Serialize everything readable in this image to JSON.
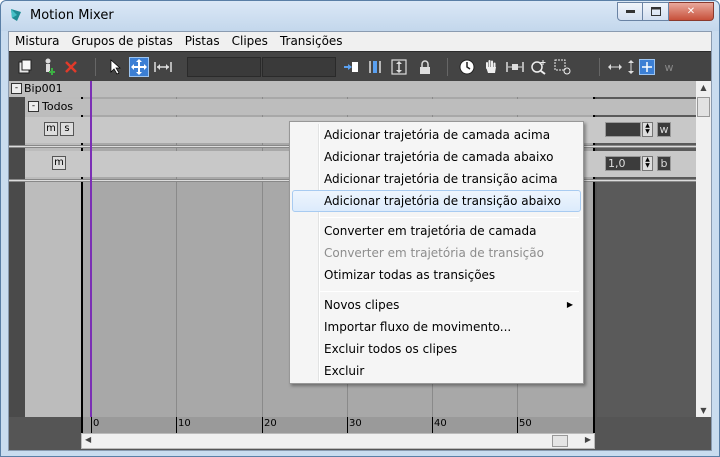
{
  "window": {
    "title": "Motion Mixer",
    "controls": {
      "minimize": "–",
      "maximize": "□",
      "close": "✕"
    }
  },
  "menubar": {
    "items": [
      "Mistura",
      "Grupos de pistas",
      "Pistas",
      "Clipes",
      "Transições"
    ]
  },
  "toolbar": {
    "icons": [
      "mixer-add-icon",
      "character-add-icon",
      "delete-icon",
      "select-arrow-icon",
      "move-icon",
      "scale-clip-icon",
      "set-range-icon",
      "snap-icon",
      "fit-icon",
      "lock-icon",
      "time-icon",
      "pan-hand-icon",
      "zoom-extents-icon",
      "zoom-icon",
      "zoom-region-icon",
      "horizontal-resize-icon",
      "vertical-resize-icon",
      "grid-toggle-icon",
      "w-icon"
    ],
    "w_label": "w"
  },
  "tracks": {
    "root_label": "Bip001",
    "root_collapse": "-",
    "group_label": "Todos",
    "group_collapse": "-",
    "track1_buttons": [
      "m",
      "s"
    ],
    "track1_weight_label": "w",
    "track2_buttons": [
      "m"
    ],
    "track2_value": "1,0",
    "track2_letter": "b"
  },
  "ruler": {
    "labels": [
      "0",
      "10",
      "20",
      "30",
      "40",
      "50"
    ]
  },
  "context_menu": {
    "items": [
      {
        "label": "Adicionar trajetória de camada acima",
        "state": "normal"
      },
      {
        "label": "Adicionar trajetória de camada abaixo",
        "state": "normal"
      },
      {
        "label": "Adicionar trajetória de transição acima",
        "state": "normal"
      },
      {
        "label": "Adicionar trajetória de transição abaixo",
        "state": "highlighted"
      },
      {
        "label": "Converter em trajetória de camada",
        "state": "normal"
      },
      {
        "label": "Converter em trajetória de transição",
        "state": "disabled"
      },
      {
        "label": "Otimizar todas as transições",
        "state": "normal"
      },
      {
        "label": "Novos clipes",
        "state": "submenu"
      },
      {
        "label": "Importar fluxo de movimento...",
        "state": "normal"
      },
      {
        "label": "Excluir todos os clipes",
        "state": "normal"
      },
      {
        "label": "Excluir",
        "state": "normal"
      }
    ],
    "submenu_arrow": "▶"
  },
  "colors": {
    "playhead": "#7b2fb5",
    "highlight_border": "#a8cbf1",
    "toolbar_bg": "#444444"
  }
}
